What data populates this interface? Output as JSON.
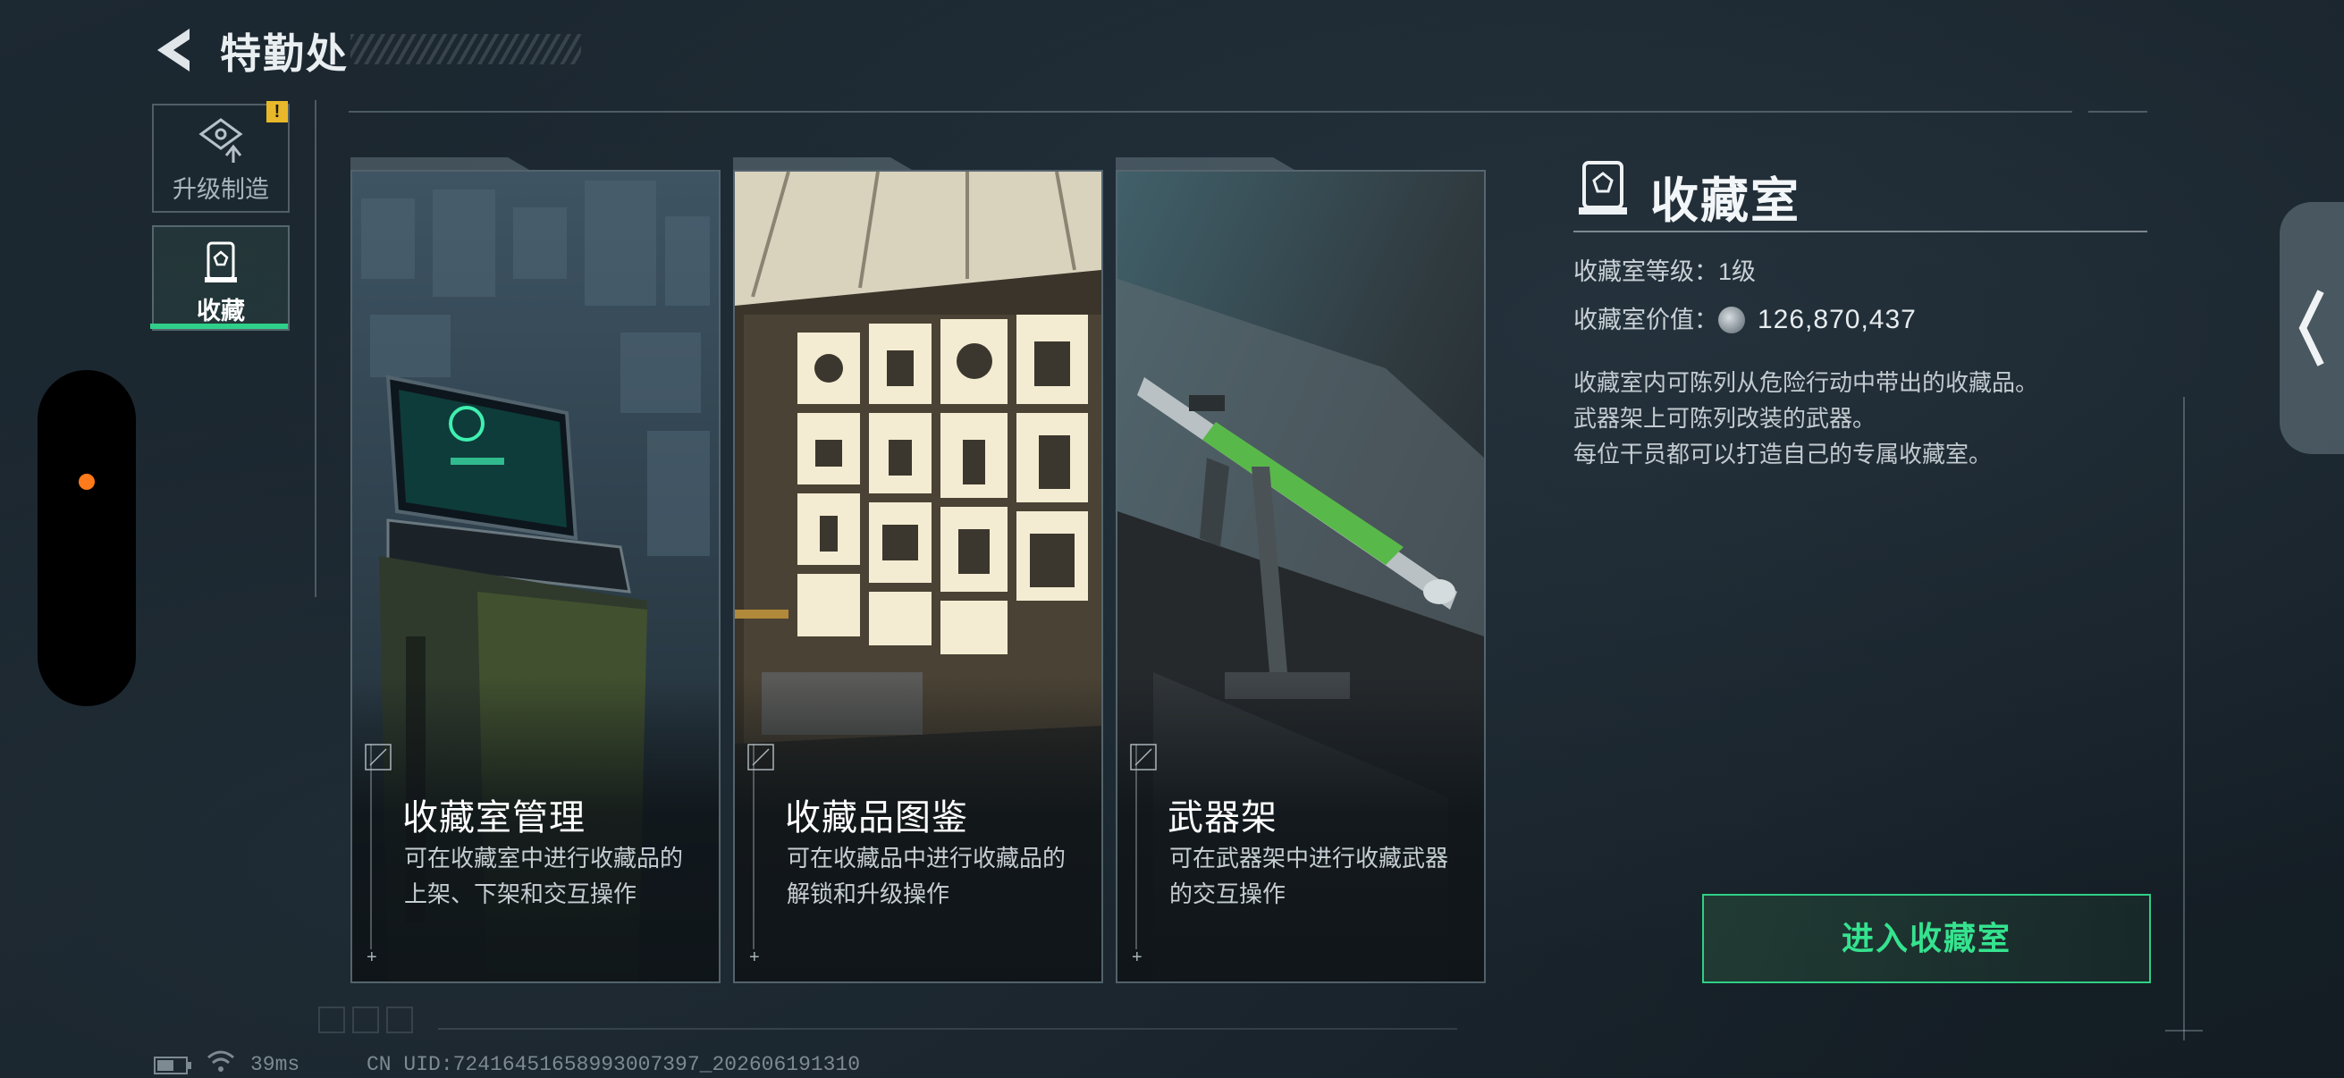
{
  "header": {
    "title": "特勤处"
  },
  "nav": {
    "items": [
      {
        "label": "升级制造",
        "badge": "!"
      },
      {
        "label": "收藏"
      }
    ]
  },
  "cards": [
    {
      "title": "收藏室管理",
      "desc_line1": "可在收藏室中进行收藏品的",
      "desc_line2": "上架、下架和交互操作"
    },
    {
      "title": "收藏品图鉴",
      "desc_line1": "可在收藏品中进行收藏品的",
      "desc_line2": "解锁和升级操作"
    },
    {
      "title": "武器架",
      "desc_line1": "可在武器架中进行收藏武器",
      "desc_line2": "的交互操作"
    }
  ],
  "info": {
    "title": "收藏室",
    "level": "收藏室等级：1级",
    "value_label": "收藏室价值：",
    "value": "126,870,437",
    "desc": [
      "收藏室内可陈列从危险行动中带出的收藏品。",
      "武器架上可陈列改装的武器。",
      "每位干员都可以打造自己的专属收藏室。"
    ],
    "enter_button": "进入收藏室"
  },
  "footer": {
    "ping": "39ms",
    "uid": "CN UID:72416451658993007397_202606191310"
  },
  "colors": {
    "accent": "#2fcf85",
    "warning": "#e7b82a",
    "dot": "#ff7a1a"
  }
}
